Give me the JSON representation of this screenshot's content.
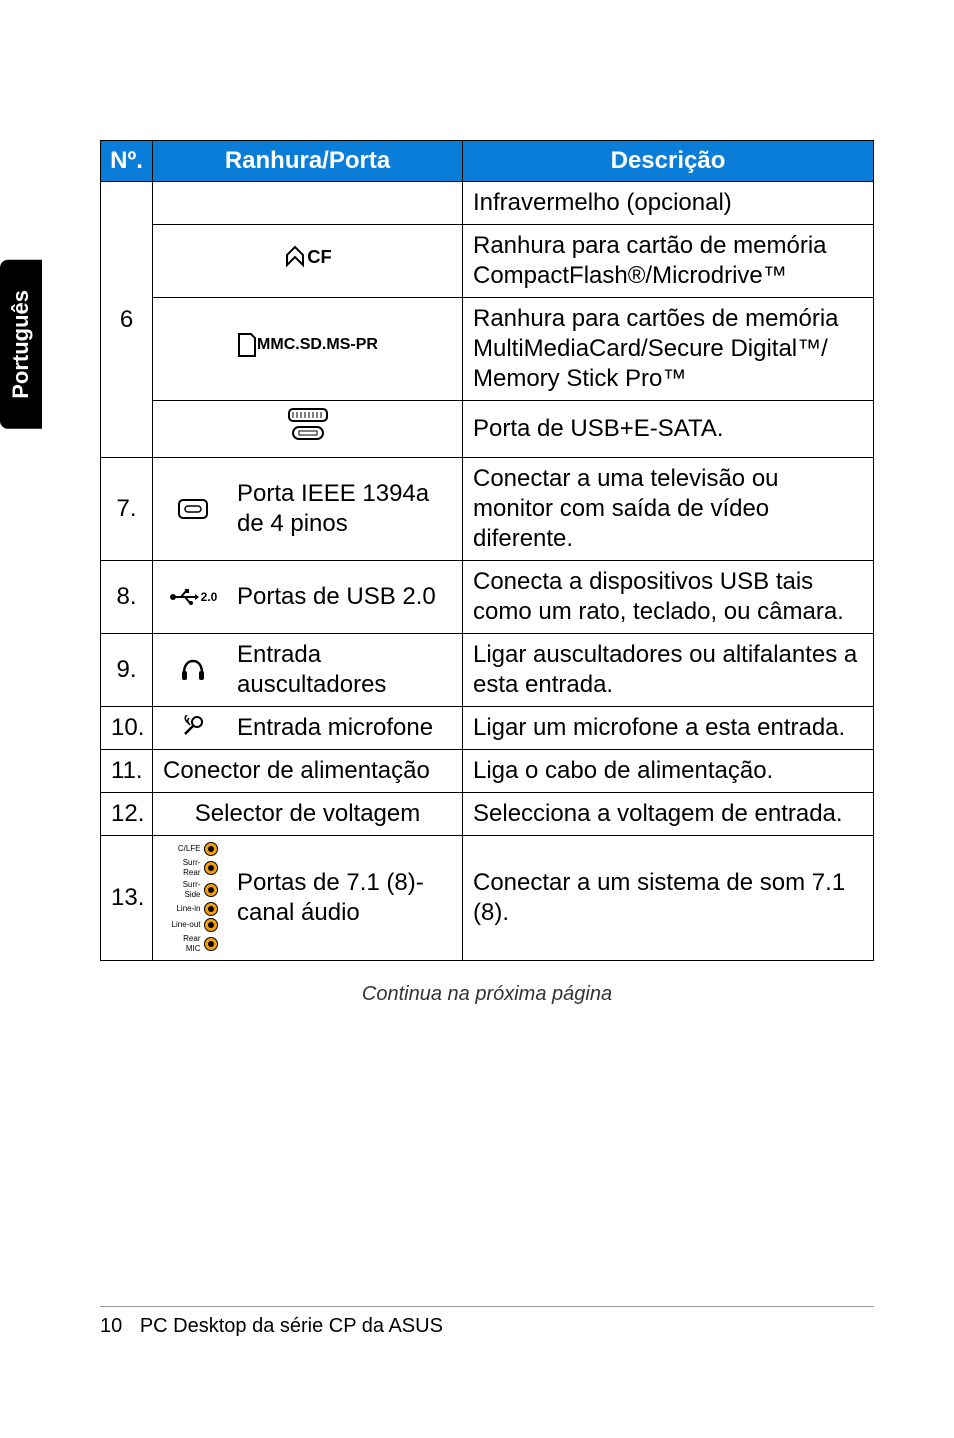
{
  "side_tab": "Português",
  "headers": {
    "num": "Nº.",
    "slot": "Ranhura/Porta",
    "desc": "Descrição"
  },
  "rows": {
    "r6_num": "6",
    "r6a_desc": "Infravermelho (opcional)",
    "r6b_desc": "Ranhura para cartão de memória CompactFlash®/Microdrive™",
    "r6c_desc": "Ranhura para cartões de memória MultiMediaCard/Secure Digital™/ Memory Stick Pro™",
    "r6d_desc": "Porta de USB+E-SATA.",
    "r7_num": "7.",
    "r7_label": "Porta IEEE 1394a de 4 pinos",
    "r7_desc": "Conectar a uma televisão ou monitor com saída de vídeo diferente.",
    "r8_num": "8.",
    "r8_label": "Portas de USB 2.0",
    "r8_desc": "Conecta a dispositivos USB tais como um rato, teclado, ou câmara.",
    "r9_num": "9.",
    "r9_label": "Entrada auscultadores",
    "r9_desc": "Ligar auscultadores ou altifalantes a esta entrada.",
    "r10_num": "10.",
    "r10_label": "Entrada microfone",
    "r10_desc": "Ligar um microfone a esta entrada.",
    "r11_num": "11.",
    "r11_label": "Conector de alimentação",
    "r11_desc": "Liga o cabo de alimentação.",
    "r12_num": "12.",
    "r12_label": "Selector de voltagem",
    "r12_desc": "Selecciona a voltagem de entrada.",
    "r13_num": "13.",
    "r13_label": "Portas de 7.1 (8)-canal áudio",
    "r13_desc": "Conectar a um sistema de som 7.1 (8)."
  },
  "icons": {
    "cf_label": "CF",
    "mmc_label": "MMC.SD.MS-PR",
    "usb_label": "2.0"
  },
  "audio_labels": [
    "C/LFE",
    "Surr-Rear",
    "Surr-Side",
    "Line-in",
    "Line-out",
    "Rear MIC"
  ],
  "caption": "Continua na próxima página",
  "footer": {
    "page": "10",
    "title": "PC Desktop da série CP da ASUS"
  }
}
